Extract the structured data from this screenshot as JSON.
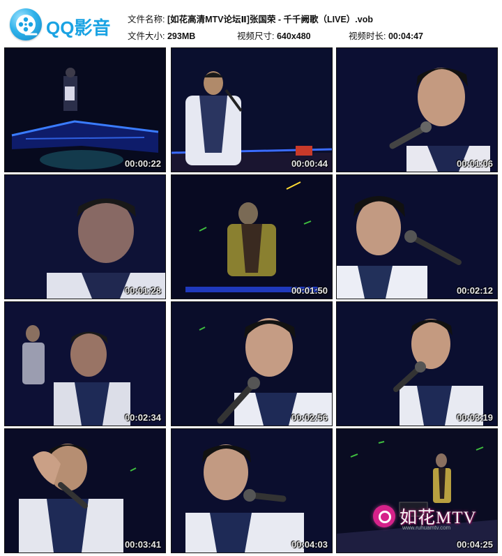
{
  "logo": {
    "text": "QQ影音",
    "icon": "qq-player-film-reel-icon"
  },
  "info": {
    "filename_label": "文件名称:",
    "filename_value": "[如花高清MTV论坛Ⅱ]张国荣 - 千千阙歌（LIVE）.vob",
    "size_label": "文件大小:",
    "size_value": "293MB",
    "dimensions_label": "视频尺寸:",
    "dimensions_value": "640x480",
    "duration_label": "视频时长:",
    "duration_value": "00:04:47"
  },
  "thumbnails": [
    {
      "timestamp": "00:00:22"
    },
    {
      "timestamp": "00:00:44"
    },
    {
      "timestamp": "00:01:06"
    },
    {
      "timestamp": "00:01:28"
    },
    {
      "timestamp": "00:01:50"
    },
    {
      "timestamp": "00:02:12"
    },
    {
      "timestamp": "00:02:34"
    },
    {
      "timestamp": "00:02:56"
    },
    {
      "timestamp": "00:03:19"
    },
    {
      "timestamp": "00:03:41"
    },
    {
      "timestamp": "00:04:03"
    },
    {
      "timestamp": "00:04:25"
    }
  ],
  "watermark": {
    "text": "如花MTV",
    "sub": "www.ruhuamtv.com"
  }
}
